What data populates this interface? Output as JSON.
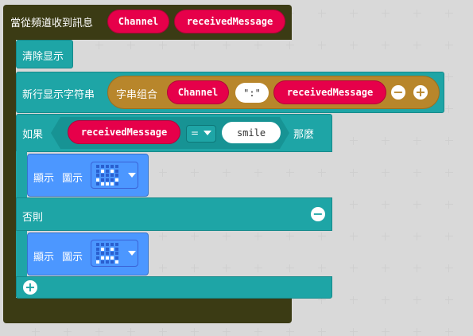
{
  "event": {
    "label": "當從頻道收到訊息",
    "param1": "Channel",
    "param2": "receivedMessage"
  },
  "clear_block": {
    "label": "清除显示"
  },
  "show_line": {
    "label": "新行显示字符串",
    "join_label": "字串组合",
    "item1": "Channel",
    "item2": "\":\"",
    "item3": "receivedMessage",
    "minus": "⊖",
    "plus": "⊕"
  },
  "if_block": {
    "if_label": "如果",
    "left": "receivedMessage",
    "operator": "=",
    "right": "smile",
    "then_label": "那麼",
    "else_label": "否則"
  },
  "show_icon_1": {
    "label1": "顯示",
    "label2": "圖示",
    "icon": "smile-led-icon"
  },
  "show_icon_2": {
    "label1": "顯示",
    "label2": "圖示",
    "icon": "frown-led-icon"
  },
  "colors": {
    "event": "#3d3d12",
    "basic_teal": "#1ea5a6",
    "text_gold": "#b8862b",
    "variable_red": "#e6004a",
    "show_blue": "#4c97ff"
  }
}
